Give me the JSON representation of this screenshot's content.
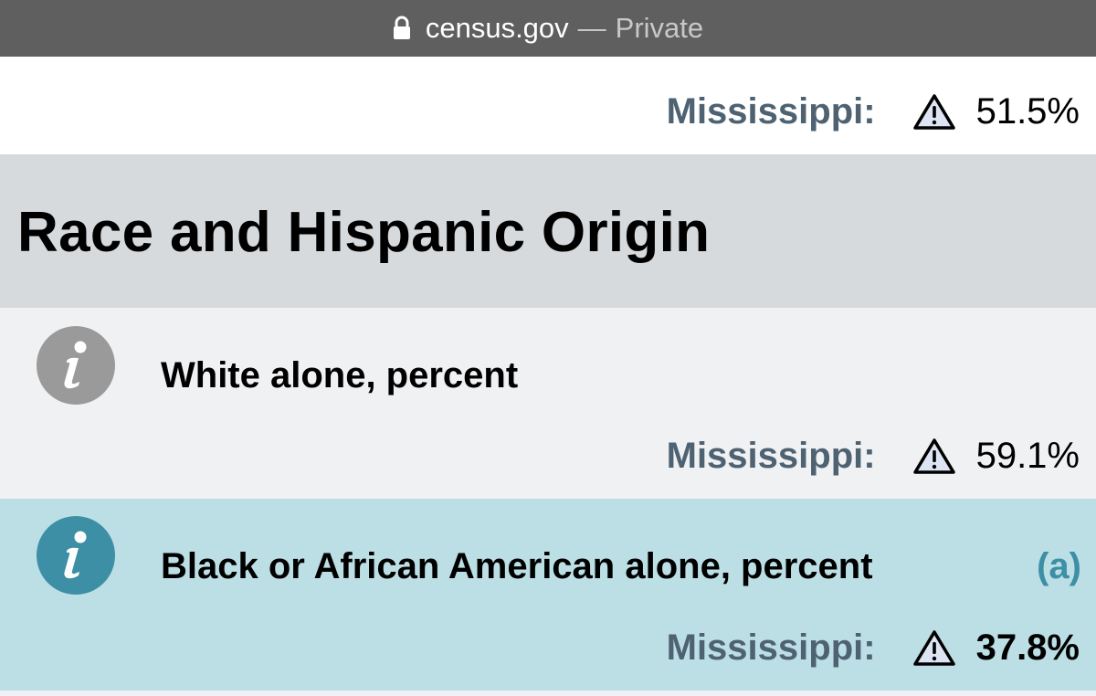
{
  "browser": {
    "domain": "census.gov",
    "separator": "—",
    "mode": "Private"
  },
  "rows": [
    {
      "state_label": "Mississippi:",
      "value": "51.5%"
    }
  ],
  "section": {
    "title": "Race and Hispanic Origin",
    "items": [
      {
        "label": "White alone, percent",
        "footnote": "",
        "state_label": "Mississippi:",
        "value": "59.1%"
      },
      {
        "label": "Black or African American alone, percent",
        "footnote": "(a)",
        "state_label": "Mississippi:",
        "value": "37.8%"
      }
    ]
  },
  "colors": {
    "address_bar": "#5f5f5f",
    "section_header_bg": "#d6dadd",
    "row_bg": "#f0f1f3",
    "highlight_row_bg": "#bcdfe6",
    "state_label": "#4e6272",
    "info_icon_gray": "#9a9a9a",
    "info_icon_teal": "#3d8fa6",
    "warning_fill": "#dde4f4"
  },
  "icons": {
    "lock": "lock-icon",
    "info": "info-icon",
    "warning": "warning-icon"
  }
}
